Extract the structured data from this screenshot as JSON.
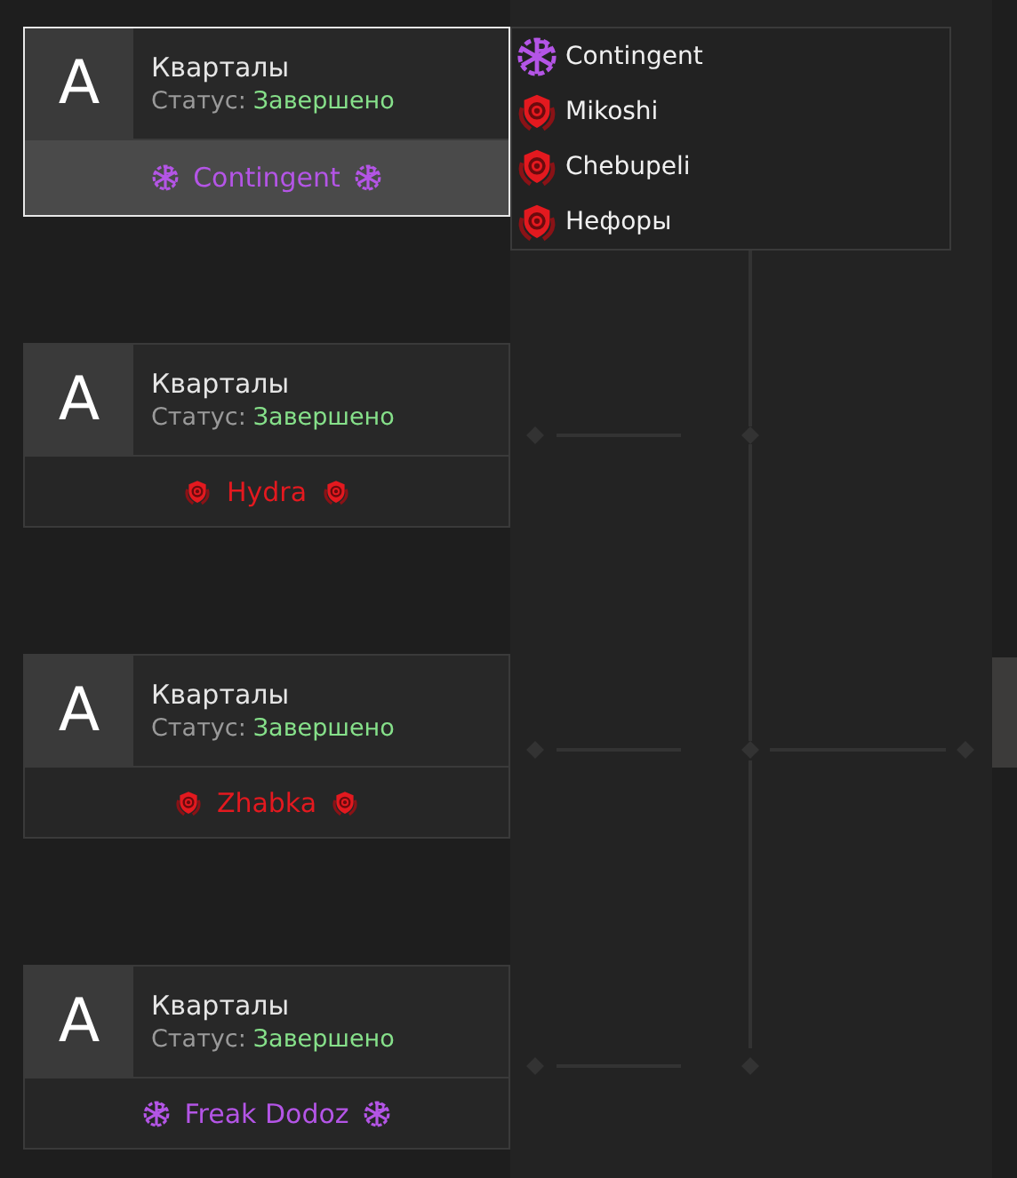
{
  "matches": [
    {
      "avatar": "A",
      "title": "Кварталы",
      "status_label": "Статус:",
      "status_value": "Завершено",
      "selected": true,
      "team": {
        "name": "Contingent",
        "kind": "wheel"
      }
    },
    {
      "avatar": "A",
      "title": "Кварталы",
      "status_label": "Статус:",
      "status_value": "Завершено",
      "selected": false,
      "team": {
        "name": "Hydra",
        "kind": "shield"
      }
    },
    {
      "avatar": "A",
      "title": "Кварталы",
      "status_label": "Статус:",
      "status_value": "Завершено",
      "selected": false,
      "team": {
        "name": "Zhabka",
        "kind": "shield"
      }
    },
    {
      "avatar": "A",
      "title": "Кварталы",
      "status_label": "Статус:",
      "status_value": "Завершено",
      "selected": false,
      "team": {
        "name": "Freak Dodoz",
        "kind": "wheel"
      }
    }
  ],
  "team_list": [
    {
      "name": "Contingent",
      "kind": "wheel"
    },
    {
      "name": "Mikoshi",
      "kind": "shield"
    },
    {
      "name": "Chebupeli",
      "kind": "shield"
    },
    {
      "name": "Нефоры",
      "kind": "shield"
    }
  ]
}
